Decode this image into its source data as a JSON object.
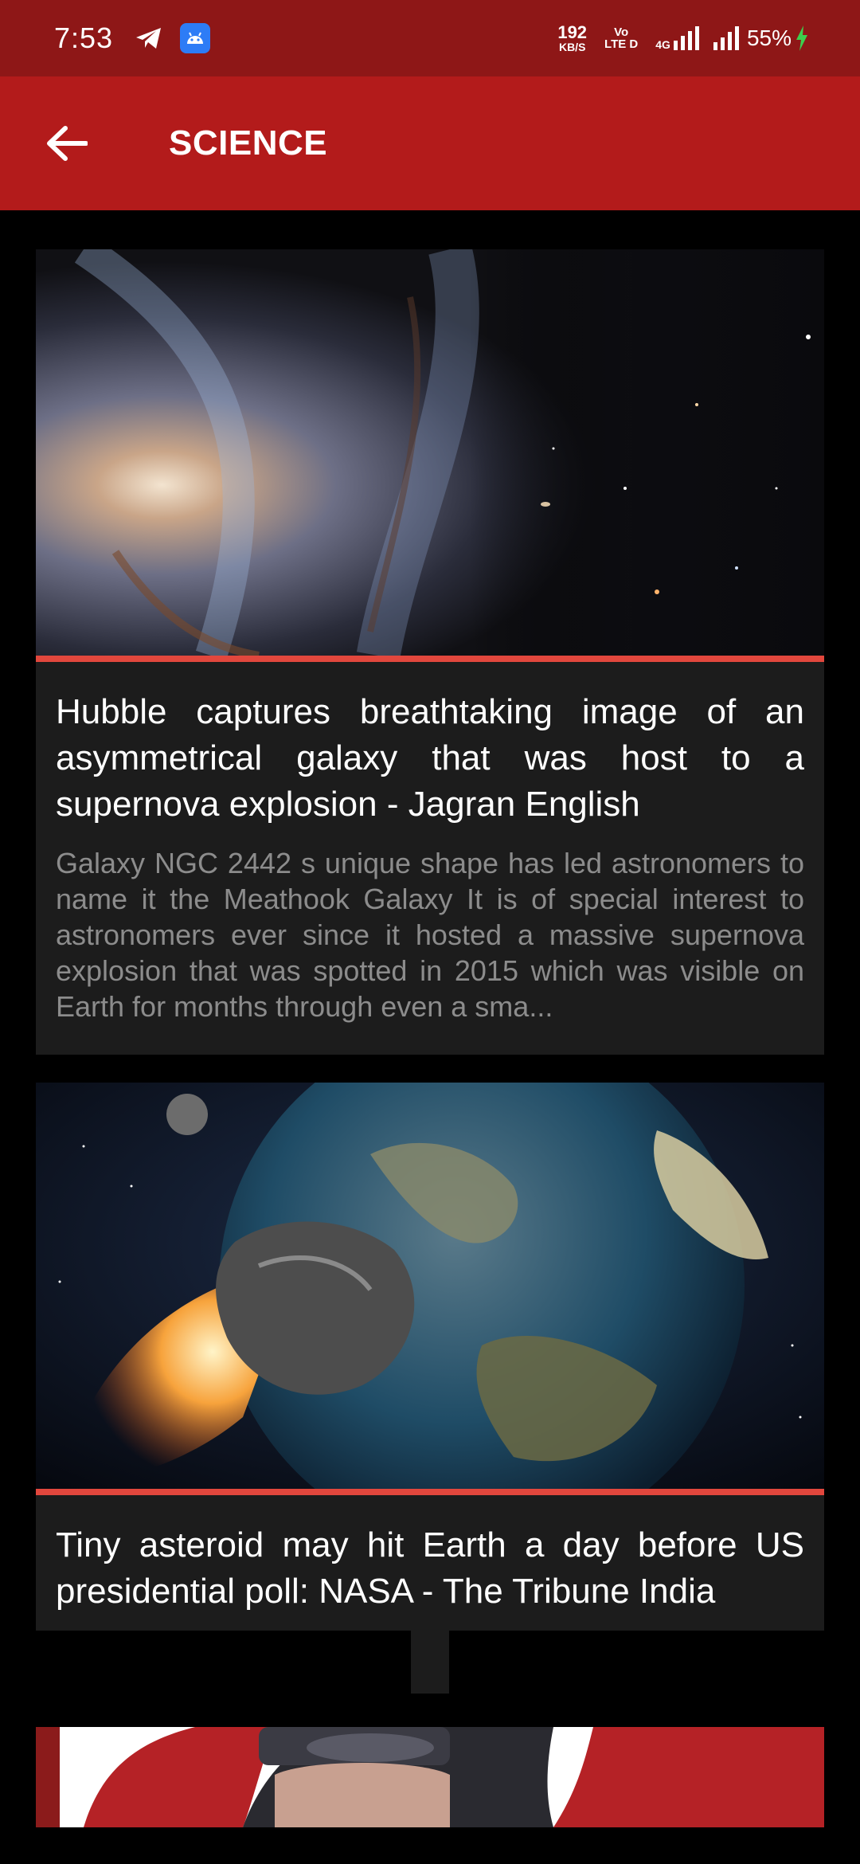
{
  "status_bar": {
    "time": "7:53",
    "net_speed_value": "192",
    "net_speed_unit": "KB/S",
    "volte_top": "Vo",
    "volte_bottom": "LTE D",
    "network_type": "4G",
    "battery": "55%",
    "icons": [
      "telegram-icon",
      "android-app-icon",
      "signal-icon",
      "battery-charging-icon"
    ]
  },
  "app_bar": {
    "back_icon": "arrow-left-icon",
    "title": "SCIENCE"
  },
  "articles": [
    {
      "image": "galaxy-photo",
      "headline": "Hubble captures breathtaking image of an asymmetrical galaxy that was host to a supernova explosion - Jagran English",
      "summary": "Galaxy NGC 2442 s unique shape has led astronomers to name it the  Meathook Galaxy  It is of special interest to astronomers ever since it hosted a massive supernova explosion that was spotted in 2015  which was visible on Earth for months through even a sma..."
    },
    {
      "image": "asteroid-earth-photo",
      "headline": "Tiny asteroid may hit Earth a day before US presidential poll: NASA - The Tribune India",
      "summary": ""
    },
    {
      "image": "person-red-jacket-photo",
      "headline": "",
      "summary": ""
    }
  ],
  "colors": {
    "status_bar": "#8e1717",
    "app_bar": "#b31b1b",
    "accent": "#e2473d",
    "card": "#1c1c1c",
    "background": "#000000"
  }
}
